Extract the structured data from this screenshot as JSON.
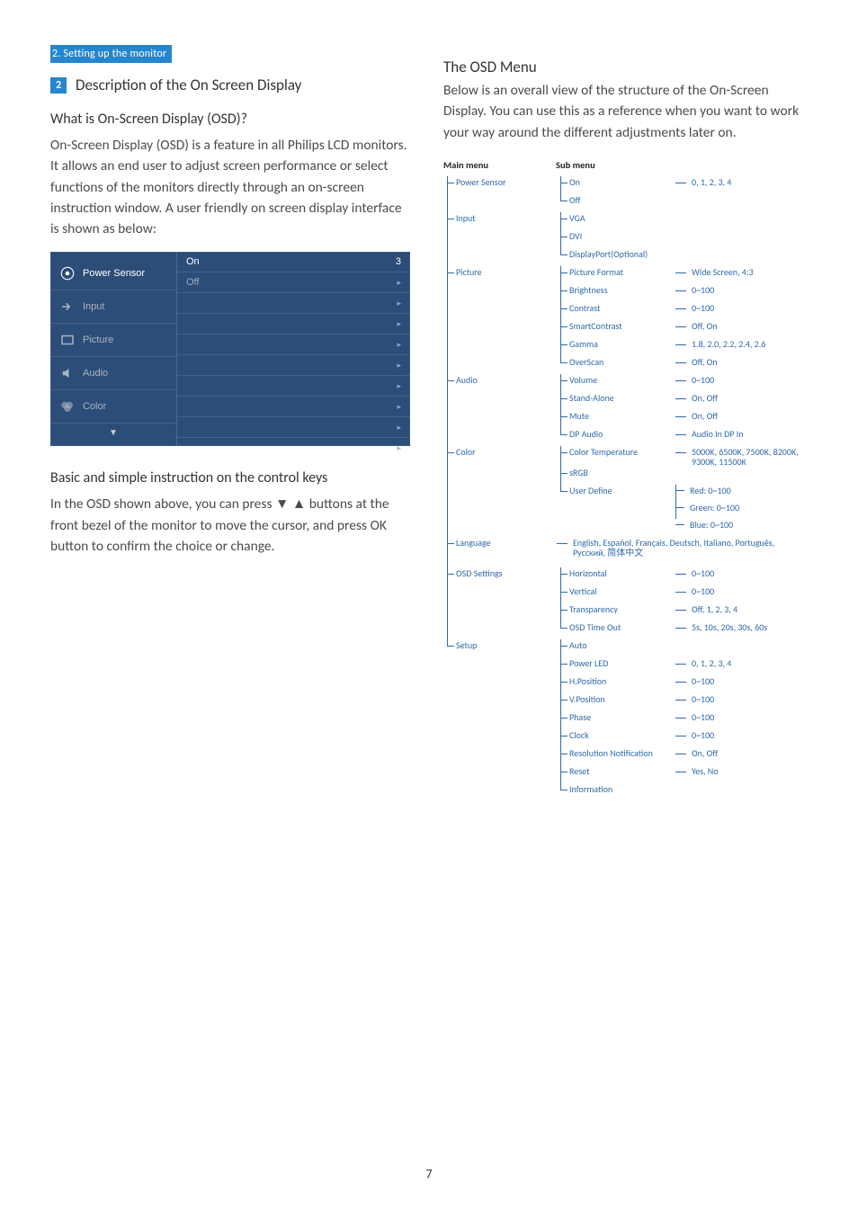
{
  "header_bar": "2. Setting up the monitor",
  "num_box": "2",
  "section_title": "Description of the On Screen Display",
  "q1": "What is On-Screen Display (OSD)?",
  "p1": "On-Screen Display (OSD) is a feature in all Philips LCD monitors. It allows an end user to adjust screen performance or select functions of the monitors directly through an on-screen instruction window. A user friendly on screen display interface is shown as below:",
  "osd": {
    "items": [
      "Power Sensor",
      "Input",
      "Picture",
      "Audio",
      "Color"
    ],
    "arrow_down": "▼",
    "rows_on": {
      "label": "On",
      "num": "3"
    },
    "rows_off": {
      "label": "Off"
    },
    "dot": "▸"
  },
  "p2_title": "Basic and simple instruction on the control keys",
  "p2": "In the OSD shown above, you can press ▼ ▲ buttons at the front bezel of the monitor to move the cursor, and press OK button to confirm the choice or change.",
  "right_title": "The OSD Menu",
  "right_p": "Below is an overall view of the structure of the On-Screen Display. You can use this as a reference when you want to work your way around the different adjustments later on.",
  "tree_header": {
    "c1": "Main menu",
    "c2": "Sub menu"
  },
  "tree": [
    {
      "main": "Power Sensor",
      "subs": [
        {
          "label": "On",
          "val": "0, 1, 2, 3, 4"
        },
        {
          "label": "Off"
        }
      ]
    },
    {
      "main": "Input",
      "subs": [
        {
          "label": "VGA"
        },
        {
          "label": "DVI"
        },
        {
          "label": "DisplayPort(Optional)"
        }
      ]
    },
    {
      "main": "Picture",
      "subs": [
        {
          "label": "Picture Format",
          "val": "Wide Screen, 4:3"
        },
        {
          "label": "Brightness",
          "val": "0~100"
        },
        {
          "label": "Contrast",
          "val": "0~100"
        },
        {
          "label": "SmartContrast",
          "val": "Off, On"
        },
        {
          "label": "Gamma",
          "val": "1.8, 2.0, 2.2, 2.4, 2.6"
        },
        {
          "label": "OverScan",
          "val": "Off, On"
        }
      ]
    },
    {
      "main": "Audio",
      "subs": [
        {
          "label": "Volume",
          "val": "0~100"
        },
        {
          "label": "Stand-Alone",
          "val": "On, Off"
        },
        {
          "label": "Mute",
          "val": "On, Off"
        },
        {
          "label": "DP Audio",
          "val": "Audio In   DP In"
        }
      ]
    },
    {
      "main": "Color",
      "subs": [
        {
          "label": "Color Temperature",
          "val": "5000K, 6500K, 7500K, 8200K, 9300K, 11500K"
        },
        {
          "label": "sRGB"
        },
        {
          "label": "User Define",
          "lines": [
            "Red: 0~100",
            "Green: 0~100",
            "Blue: 0~100"
          ]
        }
      ]
    },
    {
      "main": "Language",
      "flat": "English, Español, Français, Deutsch, Italiano, Português, Русский, 简体中文"
    },
    {
      "main": "OSD Settings",
      "subs": [
        {
          "label": "Horizontal",
          "val": "0~100"
        },
        {
          "label": "Vertical",
          "val": "0~100"
        },
        {
          "label": "Transparency",
          "val": "Off, 1, 2, 3, 4"
        },
        {
          "label": "OSD Time Out",
          "val": "5s, 10s, 20s, 30s, 60s"
        }
      ]
    },
    {
      "main": "Setup",
      "last": true,
      "subs": [
        {
          "label": "Auto"
        },
        {
          "label": "Power LED",
          "val": "0, 1, 2, 3, 4"
        },
        {
          "label": "H.Position",
          "val": "0~100"
        },
        {
          "label": "V.Position",
          "val": "0~100"
        },
        {
          "label": "Phase",
          "val": "0~100"
        },
        {
          "label": "Clock",
          "val": "0~100"
        },
        {
          "label": "Resolution Notification",
          "val": "On, Off"
        },
        {
          "label": "Reset",
          "val": "Yes, No"
        },
        {
          "label": "Information"
        }
      ]
    }
  ],
  "pagenum": "7"
}
